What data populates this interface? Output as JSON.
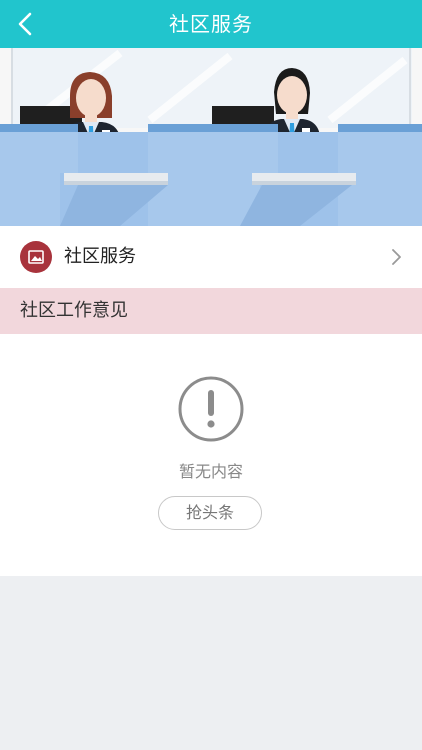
{
  "header": {
    "title": "社区服务",
    "back_icon": "chevron-left-icon",
    "color": "#21c5cd"
  },
  "service_row": {
    "label": "社区服务",
    "icon": "image-icon",
    "icon_color": "#a8333c",
    "arrow_icon": "chevron-right-icon"
  },
  "section": {
    "title": "社区工作意见",
    "background": "#f2d7dc"
  },
  "empty_state": {
    "icon": "exclamation-circle-icon",
    "message": "暂无内容",
    "button_label": "抢头条"
  }
}
